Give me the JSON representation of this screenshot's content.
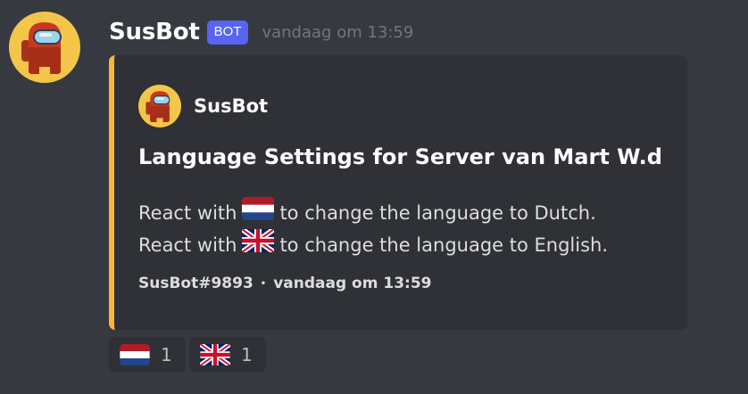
{
  "message": {
    "username": "SusBot",
    "bot_tag": "BOT",
    "timestamp": "vandaag om 13:59"
  },
  "embed": {
    "accent_color": "#f7b63b",
    "author_name": "SusBot",
    "title": "Language Settings for Server van Mart W.d",
    "lines": [
      {
        "prefix": "React with",
        "emoji": "nl-flag-icon",
        "suffix": "to change the language to Dutch."
      },
      {
        "prefix": "React with",
        "emoji": "gb-flag-icon",
        "suffix": "to change the language to English."
      }
    ],
    "footer_tag": "SusBot#9893",
    "footer_separator": "•",
    "footer_timestamp": "vandaag om 13:59"
  },
  "reactions": [
    {
      "emoji": "nl-flag-icon",
      "count": "1"
    },
    {
      "emoji": "gb-flag-icon",
      "count": "1"
    }
  ],
  "colors": {
    "background": "#36393f",
    "embed_background": "#2f3136",
    "bot_tag": "#5865f2",
    "avatar_background": "#f3c64a"
  }
}
